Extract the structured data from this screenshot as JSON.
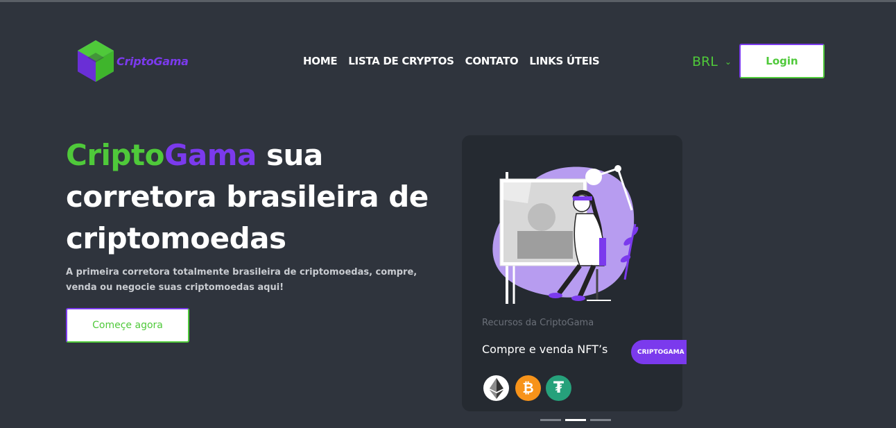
{
  "brand": {
    "name": "CriptoGama",
    "colors": {
      "green": "#4fc93a",
      "purple": "#7b3aed",
      "background": "#2f343d",
      "card": "#252a31"
    }
  },
  "nav": {
    "items": [
      "HOME",
      "LISTA DE CRYPTOS",
      "CONTATO",
      "LINKS ÚTEIS"
    ]
  },
  "header": {
    "currency": "BRL",
    "login_label": "Login"
  },
  "hero": {
    "title_part1": "Cripto",
    "title_part2": "Gama",
    "title_rest_line1": " sua",
    "title_line2": "corretora brasileira de",
    "title_line3": "criptomoedas",
    "subtitle": "A primeira corretora totalmente brasileira de criptomoedas, compre, venda ou negocie suas criptomoedas aqui!",
    "cta_label": "Começe agora"
  },
  "card": {
    "kicker": "Recursos da CriptoGama",
    "title": "Compre e venda NFT’s",
    "tag": "CRIPTOGAMA",
    "coins": [
      "ethereum-icon",
      "bitcoin-icon",
      "tether-icon"
    ],
    "btc_symbol": "₿",
    "usdt_symbol": "₮"
  },
  "carousel": {
    "slides": 3,
    "active_index": 1
  }
}
